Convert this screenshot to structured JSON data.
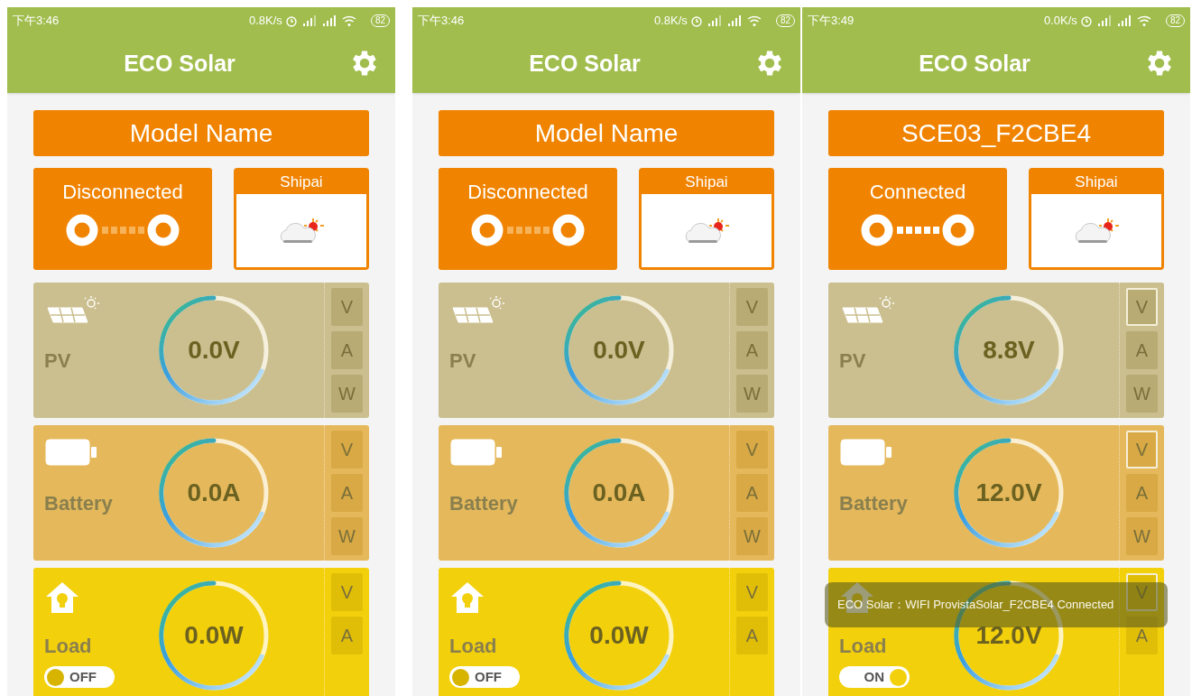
{
  "screens": [
    {
      "status_bar": {
        "time": "下午3:46",
        "net_speed": "0.8K/s",
        "battery": "82"
      },
      "title": "ECO Solar",
      "model_name": "Model Name",
      "connection": {
        "label": "Disconnected",
        "connected": false
      },
      "weather": {
        "city": "Shipai"
      },
      "meters": [
        {
          "kind": "pv",
          "label": "PV",
          "reading": "0.0V",
          "units": [
            {
              "label": "V",
              "selected": false
            },
            {
              "label": "A",
              "selected": false
            },
            {
              "label": "W",
              "selected": false
            }
          ]
        },
        {
          "kind": "battery",
          "label": "Battery",
          "reading": "0.0A",
          "units": [
            {
              "label": "V",
              "selected": false
            },
            {
              "label": "A",
              "selected": false
            },
            {
              "label": "W",
              "selected": false
            }
          ]
        },
        {
          "kind": "load",
          "label": "Load",
          "reading": "0.0W",
          "units": [
            {
              "label": "V",
              "selected": false
            },
            {
              "label": "A",
              "selected": false
            }
          ],
          "switch": {
            "label": "OFF",
            "on": false
          }
        }
      ]
    },
    {
      "status_bar": {
        "time": "下午3:46",
        "net_speed": "0.8K/s",
        "battery": "82"
      },
      "title": "ECO Solar",
      "model_name": "Model Name",
      "connection": {
        "label": "Disconnected",
        "connected": false
      },
      "weather": {
        "city": "Shipai"
      },
      "meters": [
        {
          "kind": "pv",
          "label": "PV",
          "reading": "0.0V",
          "units": [
            {
              "label": "V",
              "selected": false
            },
            {
              "label": "A",
              "selected": false
            },
            {
              "label": "W",
              "selected": false
            }
          ]
        },
        {
          "kind": "battery",
          "label": "Battery",
          "reading": "0.0A",
          "units": [
            {
              "label": "V",
              "selected": false
            },
            {
              "label": "A",
              "selected": false
            },
            {
              "label": "W",
              "selected": false
            }
          ]
        },
        {
          "kind": "load",
          "label": "Load",
          "reading": "0.0W",
          "units": [
            {
              "label": "V",
              "selected": false
            },
            {
              "label": "A",
              "selected": false
            }
          ],
          "switch": {
            "label": "OFF",
            "on": false
          }
        }
      ]
    },
    {
      "status_bar": {
        "time": "下午3:49",
        "net_speed": "0.0K/s",
        "battery": "82"
      },
      "title": "ECO Solar",
      "model_name": "SCE03_F2CBE4",
      "connection": {
        "label": "Connected",
        "connected": true
      },
      "weather": {
        "city": "Shipai"
      },
      "meters": [
        {
          "kind": "pv",
          "label": "PV",
          "reading": "8.8V",
          "units": [
            {
              "label": "V",
              "selected": true
            },
            {
              "label": "A",
              "selected": false
            },
            {
              "label": "W",
              "selected": false
            }
          ]
        },
        {
          "kind": "battery",
          "label": "Battery",
          "reading": "12.0V",
          "units": [
            {
              "label": "V",
              "selected": true
            },
            {
              "label": "A",
              "selected": false
            },
            {
              "label": "W",
              "selected": false
            }
          ]
        },
        {
          "kind": "load",
          "label": "Load",
          "reading": "12.0V",
          "units": [
            {
              "label": "V",
              "selected": true
            },
            {
              "label": "A",
              "selected": false
            }
          ],
          "switch": {
            "label": "ON",
            "on": true
          }
        }
      ],
      "toast": "ECO Solar：WIFI ProvistaSolar_F2CBE4 Connected"
    }
  ]
}
